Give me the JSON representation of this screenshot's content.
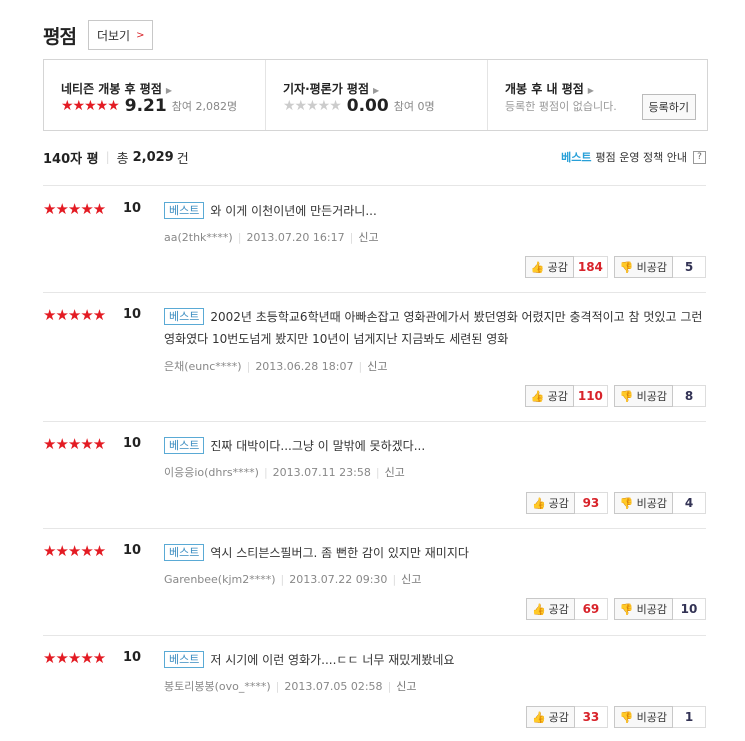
{
  "header": {
    "title": "평점",
    "more_label": "더보기"
  },
  "summary": {
    "netizen": {
      "title": "네티즌 개봉 후 평점",
      "stars": "★★★★★",
      "score": "9.21",
      "participants": "참여 2,082명"
    },
    "critic": {
      "title": "기자·평론가 평점",
      "stars": "★★★★★",
      "score": "0.00",
      "participants": "참여 0명"
    },
    "mine": {
      "title": "개봉 후 내 평점",
      "note": "등록한 평점이 없습니다.",
      "register_label": "등록하기"
    }
  },
  "count_bar": {
    "label": "140자 평",
    "total_prefix": "총",
    "total": "2,029",
    "total_unit": "건",
    "policy_best": "베스트",
    "policy_text": "평점 운영 정책 안내",
    "help": "?"
  },
  "reviews": [
    {
      "stars": "★★★★★",
      "score": "10",
      "badge": "베스트",
      "text": "와 이게 이천이년에 만든거라니...",
      "user": "aa(2thk****)",
      "date": "2013.07.20 16:17",
      "report": "신고",
      "up_label": "공감",
      "up": "184",
      "down_label": "비공감",
      "down": "5"
    },
    {
      "stars": "★★★★★",
      "score": "10",
      "badge": "베스트",
      "text": "2002년 초등학교6학년때 아빠손잡고 영화관에가서 봤던영화 어렸지만 충격적이고 참 멋있고 그런영화였다 10번도넘게 봤지만 10년이 넘게지난 지금봐도 세련된 영화",
      "user": "은채(eunc****)",
      "date": "2013.06.28 18:07",
      "report": "신고",
      "up_label": "공감",
      "up": "110",
      "down_label": "비공감",
      "down": "8"
    },
    {
      "stars": "★★★★★",
      "score": "10",
      "badge": "베스트",
      "text": "진짜 대박이다...그냥 이 말밖에 못하겠다...",
      "user": "이응응io(dhrs****)",
      "date": "2013.07.11 23:58",
      "report": "신고",
      "up_label": "공감",
      "up": "93",
      "down_label": "비공감",
      "down": "4"
    },
    {
      "stars": "★★★★★",
      "score": "10",
      "badge": "베스트",
      "text": "역시 스티븐스필버그. 좀 뻔한 감이 있지만 재미지다",
      "user": "Garenbee(kjm2****)",
      "date": "2013.07.22 09:30",
      "report": "신고",
      "up_label": "공감",
      "up": "69",
      "down_label": "비공감",
      "down": "10"
    },
    {
      "stars": "★★★★★",
      "score": "10",
      "badge": "베스트",
      "text": "저 시기에 이런 영화가....ㄷㄷ 너무 재밌게봤네요",
      "user": "봉토리봉봉(ovo_****)",
      "date": "2013.07.05 02:58",
      "report": "신고",
      "up_label": "공감",
      "up": "33",
      "down_label": "비공감",
      "down": "1"
    }
  ]
}
